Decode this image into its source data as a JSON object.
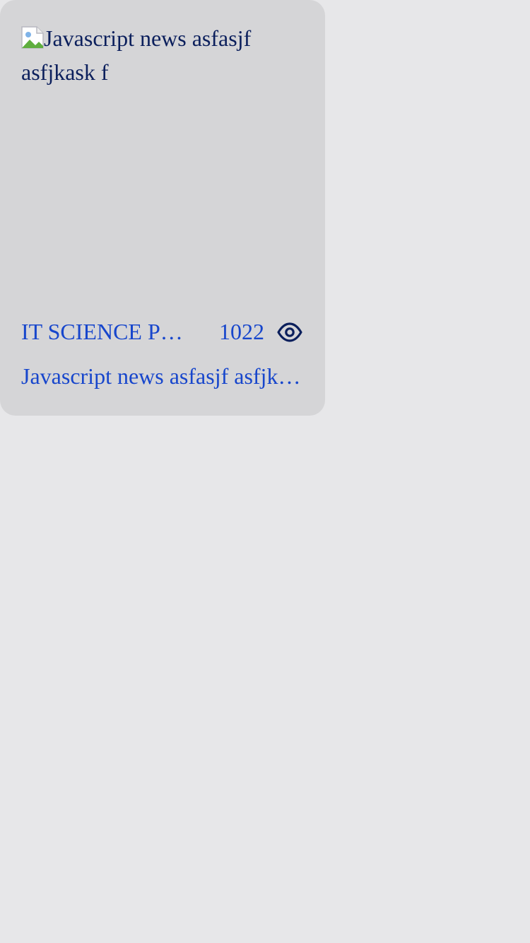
{
  "card": {
    "image_alt": "Javascript news asfasjf asfjkask f",
    "category": "IT SCIENCE P…",
    "views": "1022",
    "views_icon": "eye-icon",
    "title": "Javascript news asfasjf asfjk…"
  },
  "colors": {
    "page_bg": "#e7e7e9",
    "card_bg": "#d5d5d7",
    "link_blue": "#1746cc",
    "dark_navy": "#0b1f5c"
  }
}
